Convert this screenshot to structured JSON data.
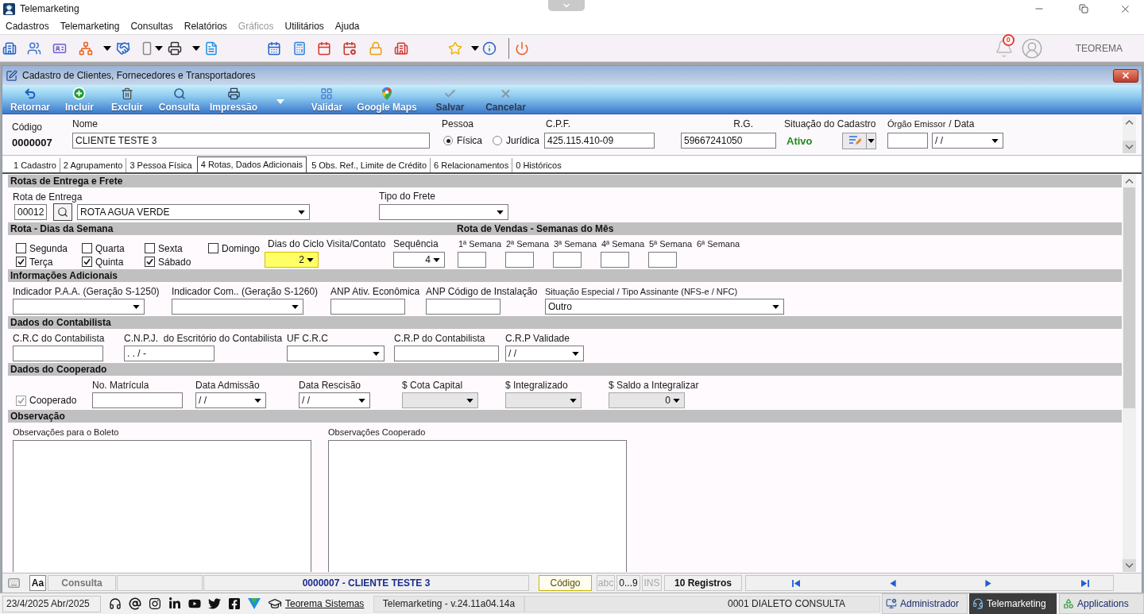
{
  "window": {
    "title": "Telemarketing"
  },
  "menu": [
    {
      "label": "Cadastros",
      "disabled": false
    },
    {
      "label": "Telemarketing",
      "disabled": false
    },
    {
      "label": "Consultas",
      "disabled": false
    },
    {
      "label": "Relatórios",
      "disabled": false
    },
    {
      "label": "Gráficos",
      "disabled": true
    },
    {
      "label": "Utilitários",
      "disabled": false
    },
    {
      "label": "Ajuda",
      "disabled": false
    }
  ],
  "toolbar": {
    "notifications": "0",
    "user": "TEOREMA"
  },
  "form": {
    "title": "Cadastro de Clientes, Fornecedores e Transportadores"
  },
  "actions": [
    {
      "label": "Retornar",
      "disabled": false,
      "has_menu": false
    },
    {
      "label": "Incluir",
      "disabled": false,
      "has_menu": false
    },
    {
      "label": "Excluir",
      "disabled": false,
      "has_menu": false
    },
    {
      "label": "Consulta",
      "disabled": false,
      "has_menu": false
    },
    {
      "label": "Impressão",
      "disabled": false,
      "has_menu": true
    },
    {
      "label": "Validar",
      "disabled": false,
      "has_menu": false
    },
    {
      "label": "Google Maps",
      "disabled": false,
      "has_menu": false
    },
    {
      "label": "Salvar",
      "disabled": true,
      "has_menu": false
    },
    {
      "label": "Cancelar",
      "disabled": true,
      "has_menu": false
    }
  ],
  "header": {
    "codigo": {
      "label": "Código",
      "value": "0000007"
    },
    "nome": {
      "label": "Nome",
      "value": "CLIENTE TESTE 3"
    },
    "pessoa": {
      "label": "Pessoa",
      "options": [
        {
          "label": "Física",
          "selected": true
        },
        {
          "label": "Jurídica",
          "selected": false
        }
      ]
    },
    "cpf": {
      "label": "C.P.F.",
      "value": "425.115.410-09"
    },
    "rg": {
      "label": "R.G.",
      "value": "59667241050"
    },
    "situacao": {
      "label": "Situação do Cadastro",
      "value": "Ativo"
    },
    "orgao": {
      "label": "Órgão Emissor",
      "data_label": "/ Data",
      "data": "/ /"
    }
  },
  "tabs": [
    {
      "label": "1 Cadastro",
      "selected": false
    },
    {
      "label": "2 Agrupamento",
      "selected": false
    },
    {
      "label": "3 Pessoa Física",
      "selected": false
    },
    {
      "label": "4 Rotas, Dados Adicionais",
      "selected": true
    },
    {
      "label": "5 Obs. Ref., Limite de Crédito",
      "selected": false
    },
    {
      "label": "6 Relacionamentos",
      "selected": false
    },
    {
      "label": "0 Históricos",
      "selected": false
    }
  ],
  "rotas": {
    "title": "Rotas de Entrega e Frete",
    "rota": {
      "label": "Rota de Entrega",
      "code": "00012",
      "value": "ROTA AGUA VERDE"
    },
    "frete": {
      "label": "Tipo do Frete"
    }
  },
  "dias": {
    "title": "Rota - Dias da Semana",
    "days": [
      {
        "label": "Segunda",
        "checked": false
      },
      {
        "label": "Terça",
        "checked": true
      },
      {
        "label": "Quarta",
        "checked": false
      },
      {
        "label": "Quinta",
        "checked": true
      },
      {
        "label": "Sexta",
        "checked": false
      },
      {
        "label": "Sábado",
        "checked": true
      },
      {
        "label": "Domingo",
        "checked": false
      }
    ],
    "ciclo": {
      "label": "Dias do Ciclo Visita/Contato",
      "value": "2",
      "focused": true
    },
    "sequencia": {
      "label": "Sequência",
      "value": "4"
    }
  },
  "semanas": {
    "title": "Rota de Vendas - Semanas do Mês",
    "weeks": [
      {
        "label": "1ª Semana",
        "kind": "field"
      },
      {
        "label": "2ª Semana",
        "kind": "field"
      },
      {
        "label": "3ª Semana",
        "kind": "field"
      },
      {
        "label": "4ª Semana",
        "kind": "field"
      },
      {
        "label": "5ª Semana",
        "kind": "field"
      },
      {
        "label": "6ª Semana",
        "kind": "label"
      }
    ]
  },
  "info": {
    "title": "Informações Adicionais",
    "fields": [
      {
        "label": "Indicador P.A.A. (Geração S-1250)",
        "kind": "combo"
      },
      {
        "label": "Indicador Com.. (Geração S-1260)",
        "kind": "combo"
      },
      {
        "label": "ANP Ativ. Econômica",
        "kind": "input"
      },
      {
        "label": "ANP Código de Instalação",
        "kind": "input"
      },
      {
        "label": "Situação Especial / Tipo Assinante (NFS-e / NFC)",
        "kind": "combo",
        "value": "Outro"
      }
    ]
  },
  "contabilista": {
    "title": "Dados do Contabilista",
    "fields": [
      {
        "label": "C.R.C do Contabilista",
        "kind": "input"
      },
      {
        "label": "C.N.P.J.  do Escritório do Contabilista",
        "kind": "input",
        "value": ". . / -"
      },
      {
        "label": "UF C.R.C",
        "kind": "combo"
      },
      {
        "label": "C.R.P do Contabilista",
        "kind": "input"
      },
      {
        "label": "C.R.P Validade",
        "kind": "combo",
        "value": "/ /"
      }
    ]
  },
  "cooperado": {
    "title": "Dados do Cooperado",
    "member": {
      "label": "Cooperado",
      "checked": true,
      "disabled": true
    },
    "fields": [
      {
        "label": "No. Matrícula",
        "kind": "input",
        "disabled": false
      },
      {
        "label": "Data Admissão",
        "kind": "combo",
        "value": "/ /",
        "disabled": false
      },
      {
        "label": "Data Rescisão",
        "kind": "combo",
        "value": "/ /",
        "disabled": false
      },
      {
        "label": "$ Cota Capital",
        "kind": "combo",
        "disabled": true
      },
      {
        "label": "$ Integralizado",
        "kind": "combo",
        "disabled": true
      },
      {
        "label": "$ Saldo a Integralizar",
        "kind": "combo",
        "value": "0",
        "disabled": true
      }
    ]
  },
  "observacao": {
    "title": "Observação",
    "boxes": [
      {
        "label": "Observações para o Boleto"
      },
      {
        "label": "Observações Cooperado"
      }
    ]
  },
  "status_bar": {
    "font_button": "Aa",
    "mode": "Consulta",
    "record": "0000007 - CLIENTE TESTE 3",
    "key": "Código",
    "indicators": [
      {
        "label": "abc",
        "active": false
      },
      {
        "label": "0...9",
        "active": true
      },
      {
        "label": "INS",
        "active": false
      }
    ],
    "count": "10 Registros"
  },
  "taskbar": {
    "date": "23/4/2025 Abr/2025",
    "brand": "Teorema Sistemas",
    "version": "Telemarketing - v.24.11a04.14a",
    "company": "0001 DIALETO CONSULTA",
    "apps": [
      {
        "label": "Administrador",
        "selected": false
      },
      {
        "label": "Telemarketing",
        "selected": true
      },
      {
        "label": "Applications",
        "selected": false
      }
    ]
  }
}
